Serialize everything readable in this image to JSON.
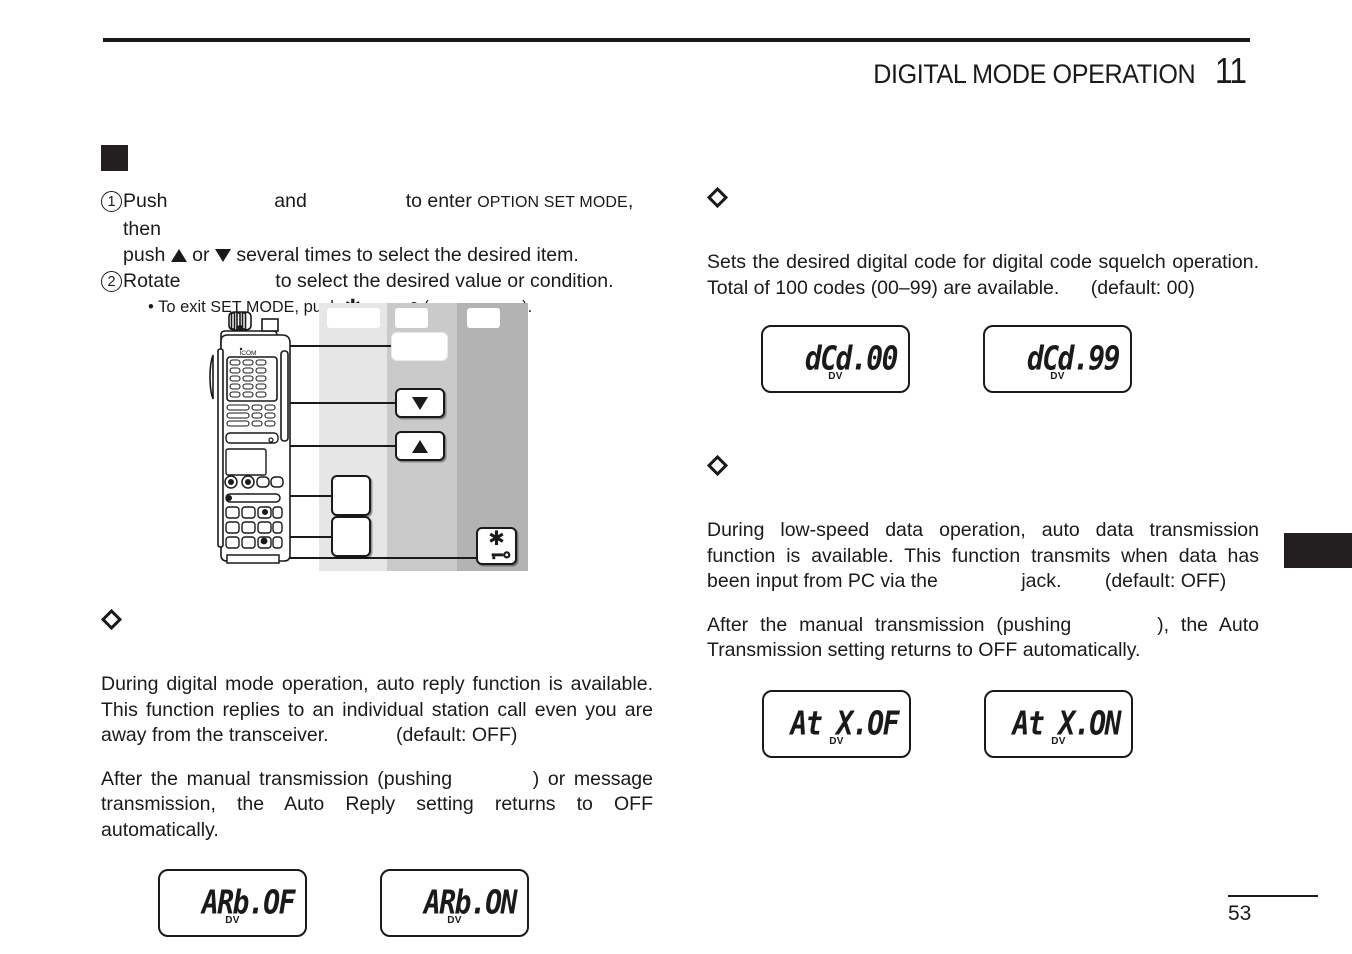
{
  "header": {
    "title": "DIGITAL MODE OPERATION",
    "chapter": "11"
  },
  "left_column": {
    "section_marker": "filled-square",
    "steps": [
      {
        "num": "①",
        "label": "Push",
        "text_1": "and",
        "text_2": "to enter",
        "smallcaps": "OPTION SET MODE",
        "text_3": ", then",
        "line2_pre": "push",
        "line2_mid": "or",
        "line2_post": "several times to select the desired item."
      },
      {
        "num": "②",
        "label": "Rotate",
        "text_1": "to select the desired value or condition.",
        "sub_pre": "• To exit",
        "sub_smallcaps": "SET MODE",
        "sub_mid": ", push",
        "sub_or": "(or",
        "sub_end": ")."
      }
    ],
    "diagram": {
      "device_label": "ICOM",
      "callouts": [
        {
          "name": "dial-callout",
          "label": ""
        },
        {
          "name": "down-callout",
          "label": "▼"
        },
        {
          "name": "up-callout",
          "label": "▲"
        },
        {
          "name": "mode-callout",
          "label": ""
        },
        {
          "name": "function-callout",
          "label": ""
        },
        {
          "name": "star-lock-callout",
          "label": "✱"
        }
      ]
    },
    "auto_reply": {
      "heading": "",
      "para_1": "During digital mode operation, auto reply function is available. This function replies to an individual station call even you are away from the transceiver.",
      "para_1_default": "(default: OFF)",
      "para_2_a": "After the manual transmission (pushing",
      "para_2_b": ") or message transmission, the Auto Reply setting returns to OFF automatically.",
      "displays": [
        {
          "text": "ARb.OF",
          "mode": "DV"
        },
        {
          "text": "ARb.ON",
          "mode": "DV"
        }
      ]
    }
  },
  "right_column": {
    "digital_code": {
      "heading": "",
      "para_1": "Sets the desired digital code for digital code squelch operation. Total of 100 codes (00–99) are available.",
      "para_1_default": "(default: 00)",
      "displays": [
        {
          "text": "dCd.00",
          "mode": "DV"
        },
        {
          "text": "dCd.99",
          "mode": "DV"
        }
      ]
    },
    "auto_tx": {
      "heading": "",
      "para_1_a": "During low-speed data operation, auto data transmission function is available. This function transmits when data has been input from PC via the",
      "para_1_b": "jack.",
      "para_1_default": "(default: OFF)",
      "para_2_a": "After the manual transmission (pushing",
      "para_2_b": "), the Auto Transmission setting returns to OFF automatically.",
      "displays": [
        {
          "text": "At X.OF",
          "mode": "DV"
        },
        {
          "text": "At X.ON",
          "mode": "DV"
        }
      ]
    }
  },
  "footer": {
    "page_number": "53"
  },
  "colors": {
    "ink": "#1a1a1a",
    "tab_black": "#231f20",
    "band_light": "#e6e6e6",
    "band_mid": "#cacaca",
    "band_dark": "#b3b3b3"
  }
}
